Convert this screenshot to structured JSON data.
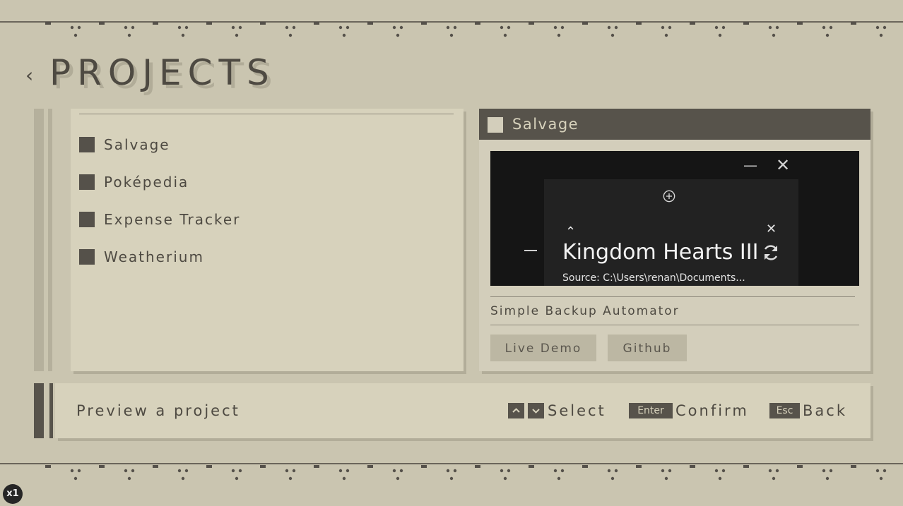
{
  "page": {
    "title": "PROJECTS",
    "back_glyph": "‹"
  },
  "projects": [
    {
      "name": "Salvage"
    },
    {
      "name": "Poképedia"
    },
    {
      "name": "Expense Tracker"
    },
    {
      "name": "Weatherium"
    }
  ],
  "detail": {
    "title": "Salvage",
    "preview": {
      "game_title": "Kingdom Hearts III",
      "source": "Source: C:\\Users\\renan\\Documents..."
    },
    "description": "Simple Backup Automator",
    "buttons": {
      "live_demo": "Live Demo",
      "github": "Github"
    }
  },
  "status": {
    "text": "Preview a project",
    "select_label": "Select",
    "confirm_key": "Enter",
    "confirm_label": "Confirm",
    "back_key": "Esc",
    "back_label": "Back"
  },
  "zoom_badge": "x1",
  "colors": {
    "background": "#cac5b0",
    "panel": "#d7d2bc",
    "dark": "#57534b",
    "text": "#4e4a42"
  },
  "icons": [
    "chevron-left-icon",
    "minimize-icon",
    "close-icon",
    "plus-circle-icon",
    "chevron-up-icon",
    "refresh-icon",
    "arrow-up-key-icon",
    "arrow-down-key-icon"
  ]
}
